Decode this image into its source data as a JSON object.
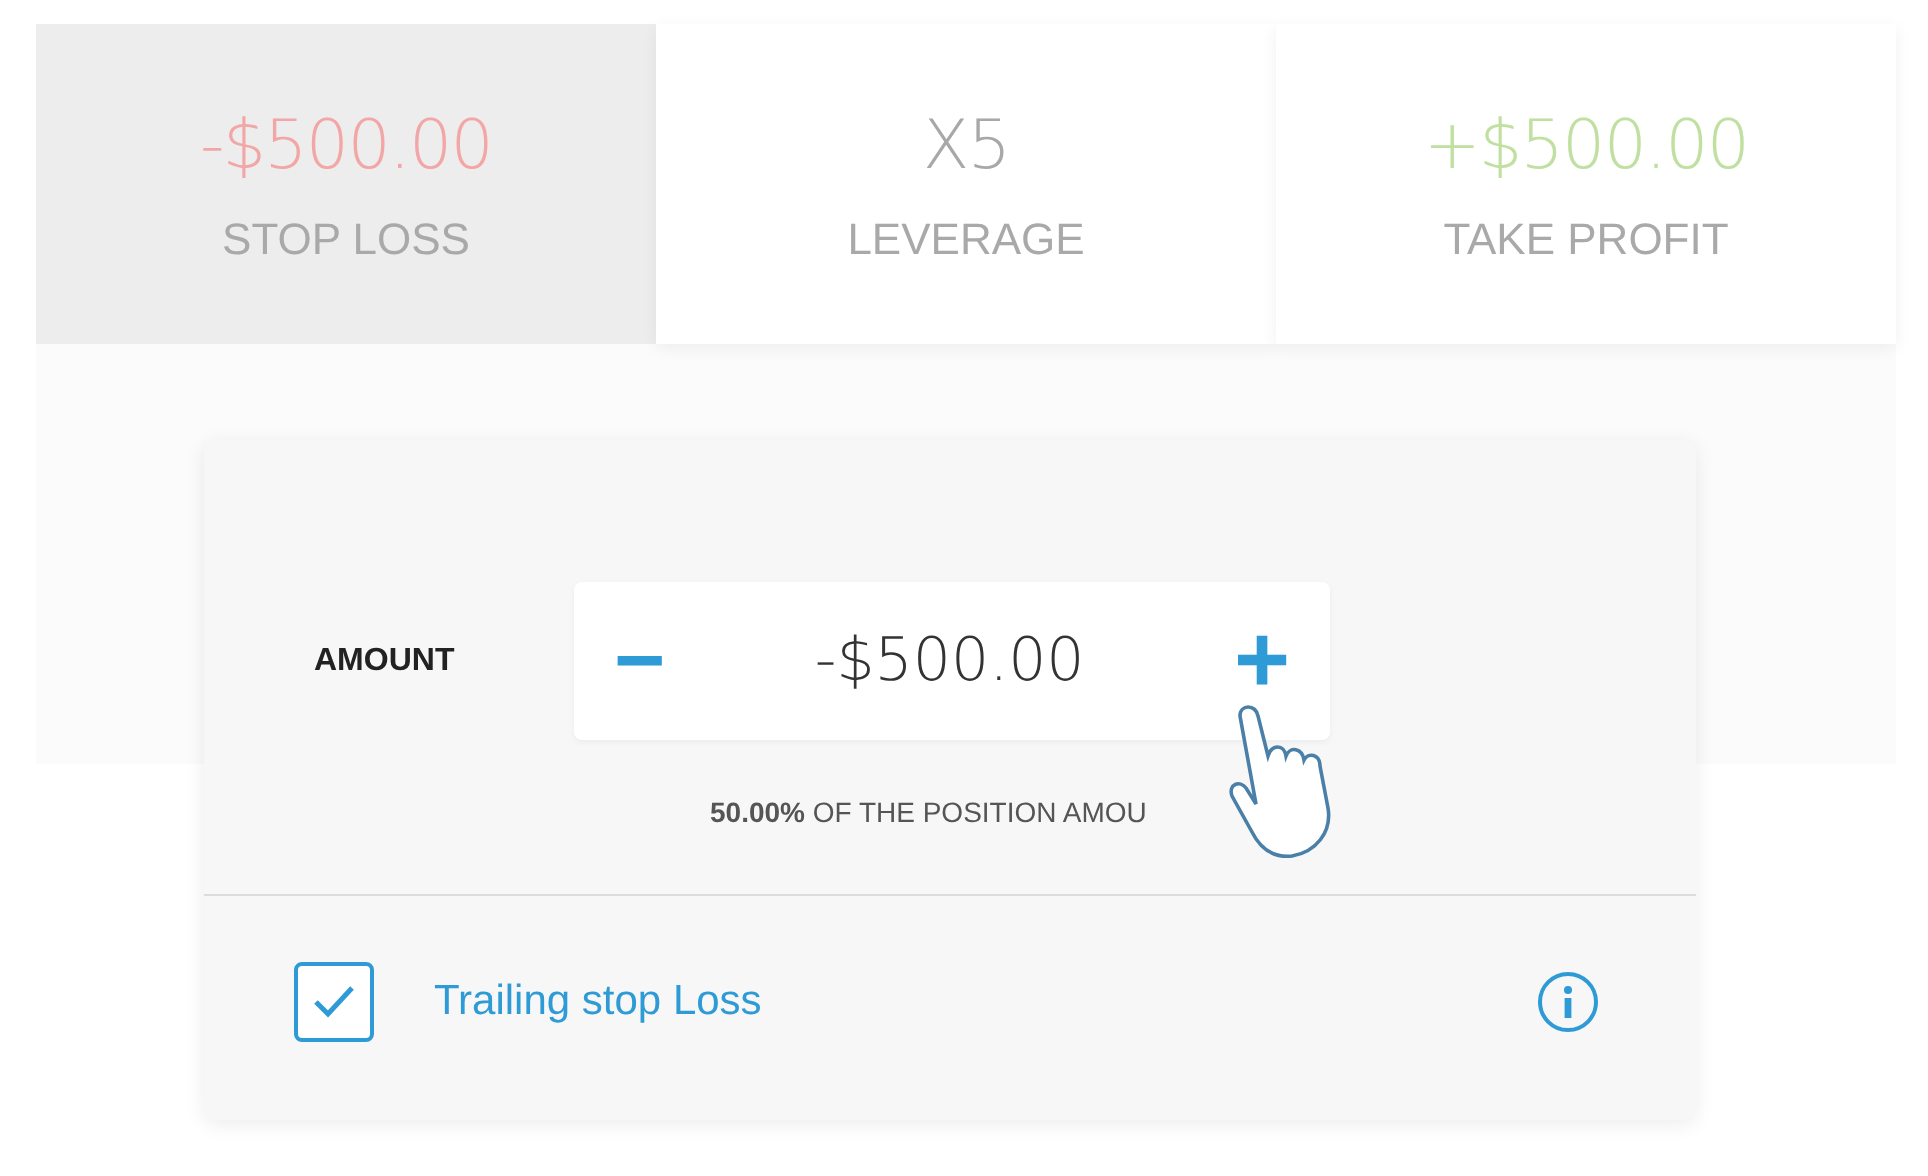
{
  "stats": [
    {
      "kind": "loss",
      "value": "-$500.00",
      "label": "STOP LOSS",
      "selected": true
    },
    {
      "kind": "neutral",
      "value": "X5",
      "label": "LEVERAGE",
      "selected": false
    },
    {
      "kind": "profit",
      "value": "+$500.00",
      "label": "TAKE PROFIT",
      "selected": false
    }
  ],
  "amount": {
    "label": "AMOUNT",
    "minus": "−",
    "value": "-$500.00",
    "plus": "+",
    "caption": "**50.00%** OF THE POSITION AMOU"
  },
  "trailing": {
    "label": "Trailing stop Loss",
    "checked": true
  }
}
